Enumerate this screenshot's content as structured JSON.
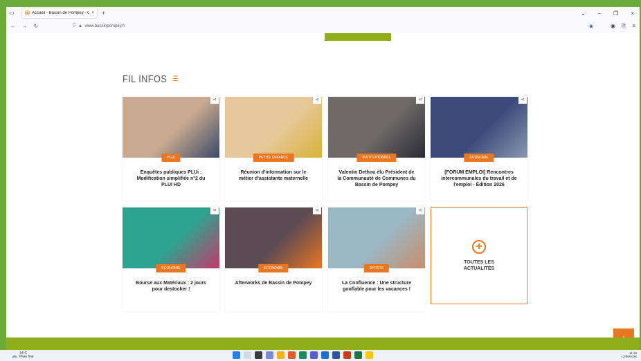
{
  "browser": {
    "tab_title": "Accueil - Bassin de Pompey - C",
    "tab_close": "×",
    "new_tab": "+",
    "url": "www.bassinpompey.fr",
    "win_min": "–",
    "win_max": "❐",
    "win_close": "×",
    "win_dropdown": "⌄"
  },
  "page": {
    "section_title": "FIL INFOS",
    "rss_icon": "rss-icon",
    "cards": [
      {
        "badge": "PLUI",
        "caption": "Enquêtes publiques PLUi : Modification simplifiée n°2 du PLUI HD",
        "img": "#c9a98f",
        "img2": "#3a4a6a"
      },
      {
        "badge": "PETITE ENFANCE",
        "caption": "Réunion d'information sur le métier d'assistante maternelle",
        "img": "#e7c89a",
        "img2": "#d8b23a"
      },
      {
        "badge": "INSTITUTIONNEL",
        "caption": "Valentin Dethou élu Président de la Communauté de Communes du Bassin de Pompey",
        "img": "#6d6a68",
        "img2": "#2b2b33"
      },
      {
        "badge": "ECONOMIE",
        "caption": "[FORUM EMPLOI] Rencontres intercommunales du travail et de l'emploi - Édition 2026",
        "img": "#3c4a7a",
        "img2": "#8a98b0"
      },
      {
        "badge": "ECONOMIE",
        "caption": "Bourse aux Matériaux : 2 jours pour destocker !",
        "img": "#2ea38f",
        "img2": "#c33a6a"
      },
      {
        "badge": "ECONOMIE",
        "caption": "Afterworks de Bassin de Pompey",
        "img": "#5a4a52",
        "img2": "#e87722"
      },
      {
        "badge": "SPORTS",
        "caption": "La Confluence : Une structure gonflable pour les vacances !",
        "img": "#9bb7c4",
        "img2": "#c88d6a"
      }
    ],
    "more_label_1": "TOUTES LES",
    "more_label_2": "ACTUALITÉS",
    "more_plus": "+",
    "scroll_top": "^"
  },
  "taskbar": {
    "temp": "14°C",
    "weather": "Pluie fine",
    "time": "11:16",
    "date": "12/05/2026"
  },
  "colors": {
    "accent": "#e87722",
    "green": "#8faf1a"
  }
}
